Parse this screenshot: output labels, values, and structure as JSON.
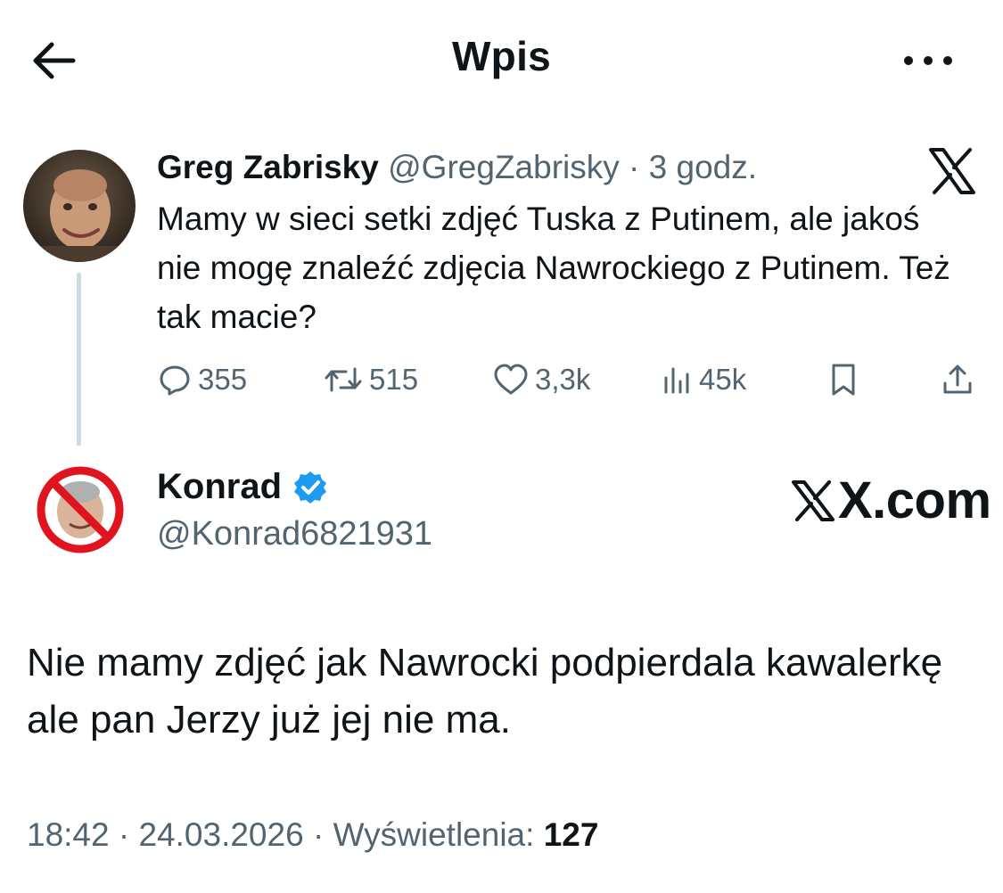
{
  "header": {
    "title": "Wpis",
    "back_icon": "arrow-left-icon",
    "more_icon": "more-horizontal-icon"
  },
  "parent_tweet": {
    "author_name": "Greg Zabrisky",
    "author_handle": "@GregZabrisky",
    "separator": "·",
    "time": "3 godz.",
    "text": "Mamy w sieci setki zdjęć Tuska z Putinem, ale jakoś nie mogę znaleźć zdjęcia Nawrockiego z Putinem. Też tak macie?",
    "stats": {
      "replies": "355",
      "reposts": "515",
      "likes": "3,3k",
      "views": "45k"
    },
    "icons": [
      "reply-icon",
      "repost-icon",
      "like-icon",
      "views-icon",
      "bookmark-icon",
      "share-icon"
    ]
  },
  "reply_tweet": {
    "author_name": "Konrad",
    "author_handle": "@Konrad6821931",
    "verified": true,
    "watermark": "X.com",
    "text": "Nie mamy zdjęć jak Nawrocki podpierdala kawalerkę ale pan Jerzy już jej nie ma.",
    "time": "18:42",
    "sep1": " · ",
    "date": "24.03.2026",
    "sep2": " · ",
    "views_label": "Wyświetlenia:",
    "views_count": "127"
  },
  "colors": {
    "text_primary": "#0f1419",
    "text_secondary": "#536471",
    "verified_blue": "#1d9bf0",
    "thread_line": "#cfd9de"
  }
}
